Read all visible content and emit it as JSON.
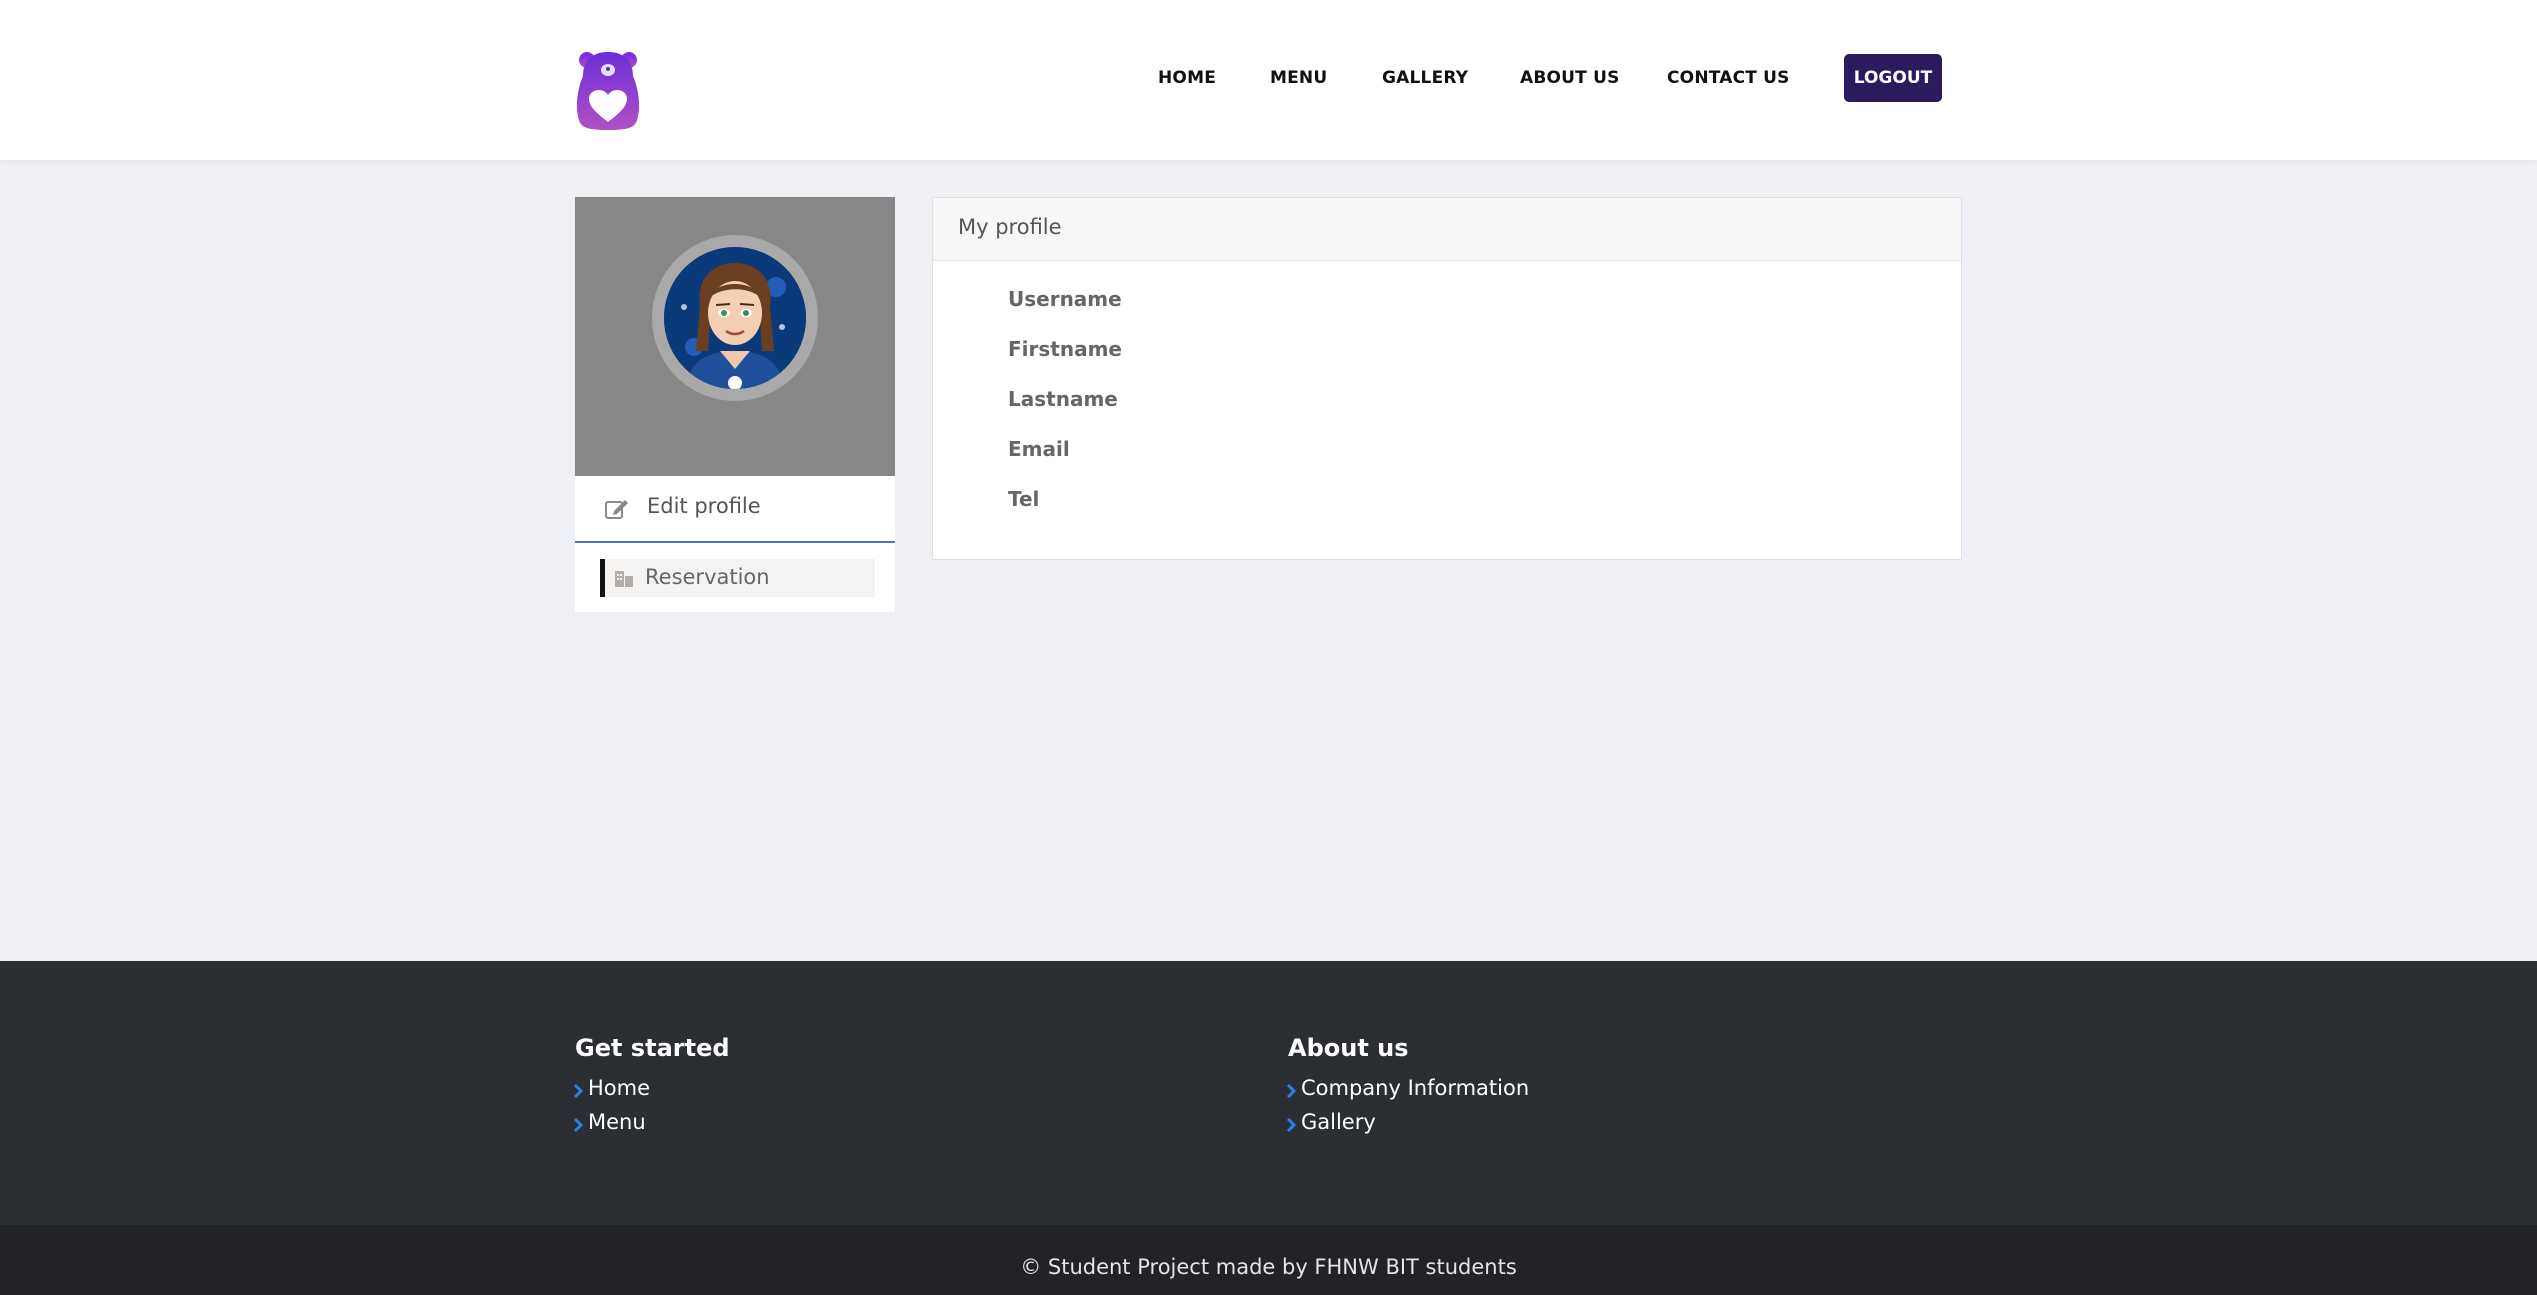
{
  "colors": {
    "accent": "#2c1a5e",
    "logo_gradient_top": "#6a2fd6",
    "logo_gradient_bottom": "#b24fc6",
    "footer_bg": "#2b2e32",
    "footer_chevron": "#2f7fe5",
    "sidebar_top_bg": "#878787",
    "page_bg": "#eff0f5"
  },
  "header": {
    "logo_icon": "bear-heart-logo",
    "nav": [
      {
        "label": "HOME"
      },
      {
        "label": "MENU"
      },
      {
        "label": "GALLERY"
      },
      {
        "label": "ABOUT US"
      },
      {
        "label": "CONTACT US"
      }
    ],
    "logout_label": "LOGOUT"
  },
  "sidebar": {
    "avatar_icon": "avatar-cartoon-woman",
    "items": [
      {
        "label": "Edit profile",
        "icon": "edit-icon"
      },
      {
        "label": "Reservation",
        "icon": "building-icon"
      }
    ]
  },
  "profile": {
    "title": "My profile",
    "fields": [
      {
        "label": "Username"
      },
      {
        "label": "Firstname"
      },
      {
        "label": "Lastname"
      },
      {
        "label": "Email"
      },
      {
        "label": "Tel"
      }
    ]
  },
  "footer": {
    "columns": [
      {
        "title": "Get started",
        "links": [
          "Home",
          "Menu"
        ]
      },
      {
        "title": "About us",
        "links": [
          "Company Information",
          "Gallery"
        ]
      }
    ],
    "copyright": "© Student Project made by FHNW BIT students"
  }
}
